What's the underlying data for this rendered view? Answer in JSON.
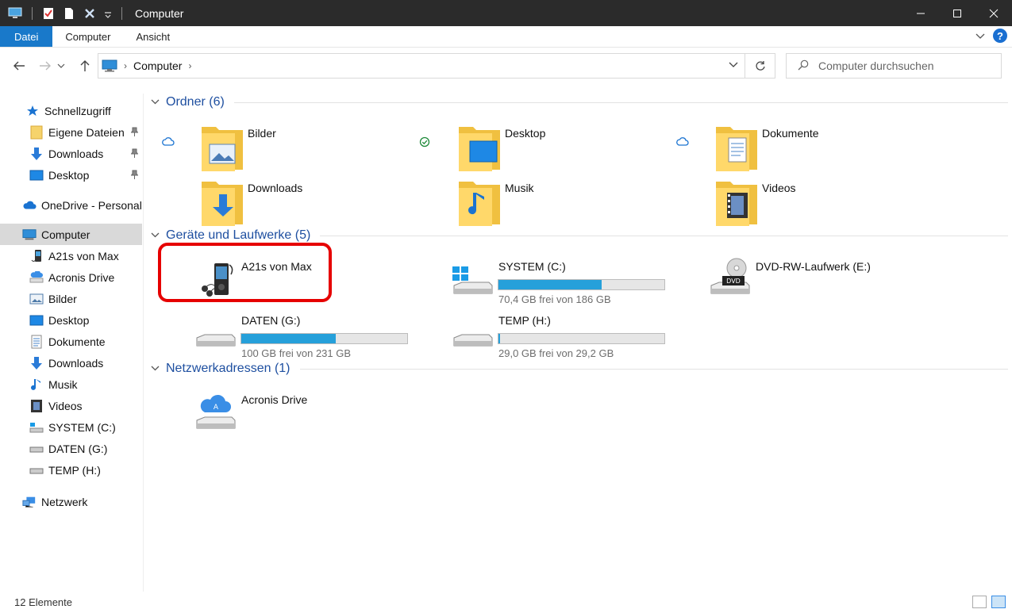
{
  "window": {
    "title": "Computer"
  },
  "ribbon": {
    "tabs": [
      "Datei",
      "Computer",
      "Ansicht"
    ]
  },
  "address": {
    "crumb": "Computer",
    "search_placeholder": "Computer durchsuchen"
  },
  "sidebar": {
    "quick_access": "Schnellzugriff",
    "items": [
      {
        "label": "Eigene Dateien",
        "pinned": true
      },
      {
        "label": "Downloads",
        "pinned": true
      },
      {
        "label": "Desktop",
        "pinned": true
      },
      {
        "label": "OneDrive - Personal"
      },
      {
        "label": "Computer",
        "selected": true
      },
      {
        "label": "A21s von Max"
      },
      {
        "label": "Acronis Drive"
      },
      {
        "label": "Bilder"
      },
      {
        "label": "Desktop"
      },
      {
        "label": "Dokumente"
      },
      {
        "label": "Downloads"
      },
      {
        "label": "Musik"
      },
      {
        "label": "Videos"
      },
      {
        "label": "SYSTEM (C:)"
      },
      {
        "label": "DATEN (G:)"
      },
      {
        "label": "TEMP (H:)"
      },
      {
        "label": "Netzwerk"
      }
    ]
  },
  "groups": {
    "folders": {
      "title": "Ordner (6)",
      "items": [
        {
          "name": "Bilder",
          "status": "cloud"
        },
        {
          "name": "Desktop",
          "status": "synced"
        },
        {
          "name": "Dokumente",
          "status": "cloud"
        },
        {
          "name": "Downloads"
        },
        {
          "name": "Musik"
        },
        {
          "name": "Videos"
        }
      ]
    },
    "drives": {
      "title": "Geräte und Laufwerke (5)",
      "items": [
        {
          "name": "A21s von Max"
        },
        {
          "name": "SYSTEM (C:)",
          "free": "70,4 GB frei von 186 GB",
          "used_fraction": 0.62
        },
        {
          "name": "DVD-RW-Laufwerk (E:)"
        },
        {
          "name": "DATEN (G:)",
          "free": "100 GB frei von 231 GB",
          "used_fraction": 0.57
        },
        {
          "name": "TEMP (H:)",
          "free": "29,0 GB frei von 29,2 GB",
          "used_fraction": 0.01
        }
      ]
    },
    "network": {
      "title": "Netzwerkadressen (1)",
      "items": [
        {
          "name": "Acronis Drive"
        }
      ]
    }
  },
  "statusbar": {
    "count": "12 Elemente"
  },
  "colors": {
    "accent": "#1979ca",
    "drive_bar": "#26a0da",
    "highlight": "#e60000",
    "group_title": "#1e4fa0"
  }
}
